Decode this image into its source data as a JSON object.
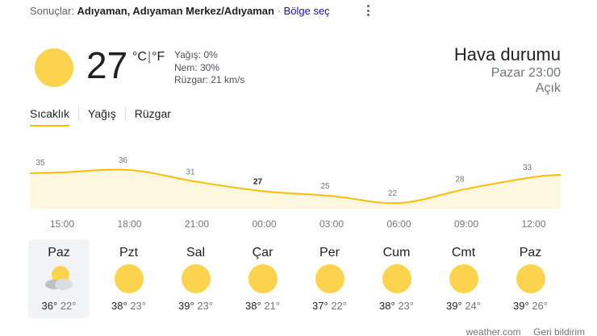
{
  "location": {
    "prefix": "Sonuçlar:",
    "name": "Adıyaman, Adıyaman Merkez/Adıyaman",
    "separator": "·",
    "change_label": "Bölge seç"
  },
  "current": {
    "temp": "27",
    "unit_c": "°C",
    "unit_sep": "|",
    "unit_f": "°F",
    "precip": "Yağış: 0%",
    "humidity": "Nem: 30%",
    "wind": "Rüzgar: 21 km/s",
    "icon": "sun-icon"
  },
  "header": {
    "title": "Hava durumu",
    "time": "Pazar 23:00",
    "condition": "Açık"
  },
  "tabs": [
    {
      "label": "Sıcaklık",
      "active": true
    },
    {
      "label": "Yağış",
      "active": false
    },
    {
      "label": "Rüzgar",
      "active": false
    }
  ],
  "chart_data": {
    "type": "area",
    "x": [
      "15:00",
      "18:00",
      "21:00",
      "00:00",
      "03:00",
      "06:00",
      "09:00",
      "12:00"
    ],
    "values": [
      35,
      36,
      31,
      27,
      25,
      22,
      28,
      33
    ],
    "labels": [
      "35",
      "36",
      "31",
      "27",
      "25",
      "22",
      "28",
      "33"
    ],
    "highlight_index": 3,
    "line_color": "#fbbc04",
    "fill_color": "#fef7e0"
  },
  "days": [
    {
      "name": "Paz",
      "high": "36°",
      "low": "22°",
      "icon": "partly-cloudy-icon",
      "active": true
    },
    {
      "name": "Pzt",
      "high": "38°",
      "low": "23°",
      "icon": "sun-icon",
      "active": false
    },
    {
      "name": "Sal",
      "high": "39°",
      "low": "23°",
      "icon": "sun-icon",
      "active": false
    },
    {
      "name": "Çar",
      "high": "38°",
      "low": "21°",
      "icon": "sun-icon",
      "active": false
    },
    {
      "name": "Per",
      "high": "37°",
      "low": "22°",
      "icon": "sun-icon",
      "active": false
    },
    {
      "name": "Cum",
      "high": "38°",
      "low": "23°",
      "icon": "sun-icon",
      "active": false
    },
    {
      "name": "Cmt",
      "high": "39°",
      "low": "24°",
      "icon": "sun-icon",
      "active": false
    },
    {
      "name": "Paz",
      "high": "39°",
      "low": "26°",
      "icon": "sun-icon",
      "active": false
    }
  ],
  "footer": {
    "source": "weather.com",
    "feedback": "Geri bildirim"
  }
}
